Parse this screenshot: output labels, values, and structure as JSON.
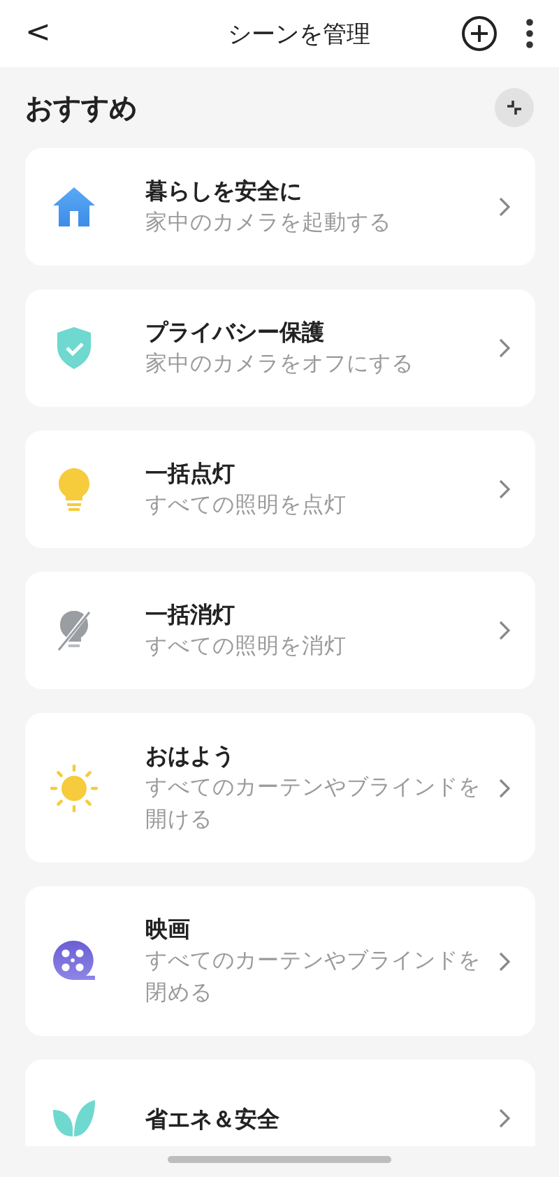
{
  "header": {
    "back": "<",
    "title": "シーンを管理"
  },
  "section": {
    "title": "おすすめ"
  },
  "scenes": [
    {
      "title": "暮らしを安全に",
      "subtitle": "家中のカメラを起動する"
    },
    {
      "title": "プライバシー保護",
      "subtitle": "家中のカメラをオフにする"
    },
    {
      "title": "一括点灯",
      "subtitle": "すべての照明を点灯"
    },
    {
      "title": "一括消灯",
      "subtitle": "すべての照明を消灯"
    },
    {
      "title": "おはよう",
      "subtitle": "すべてのカーテンやブラインドを開ける"
    },
    {
      "title": "映画",
      "subtitle": "すべてのカーテンやブラインドを閉める"
    },
    {
      "title": "省エネ＆安全"
    }
  ]
}
